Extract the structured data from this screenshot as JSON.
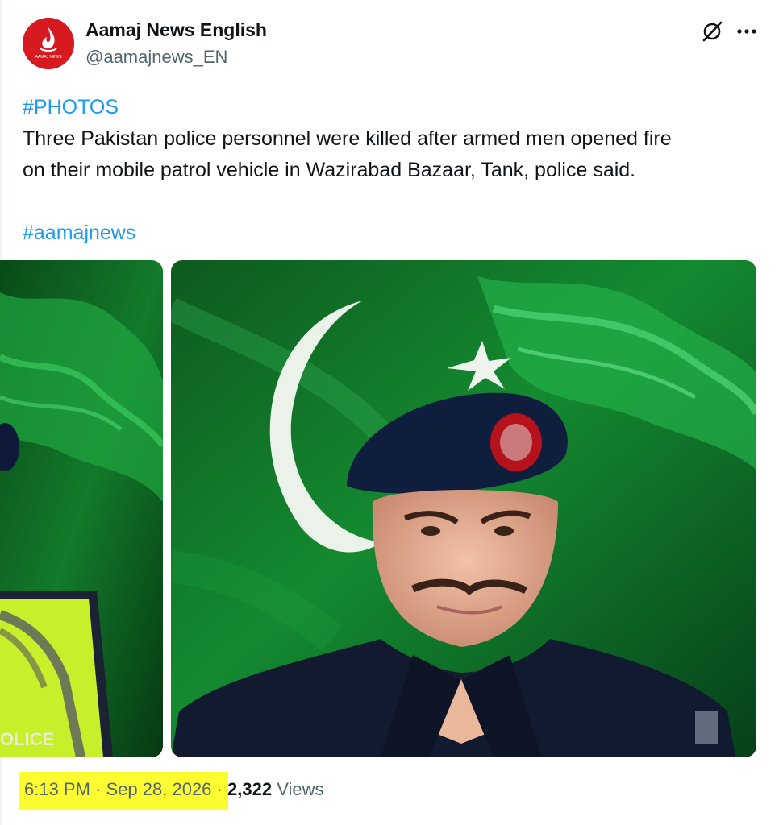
{
  "author": {
    "name": "Aamaj News English",
    "handle": "@aamajnews_EN",
    "avatar_text": "AAMAJ NEWS"
  },
  "tweet": {
    "hashtag_top": "#PHOTOS",
    "text_line_1": "Three Pakistan police personnel were killed after armed men opened fire",
    "text_line_2": "on their mobile patrol vehicle in Wazirabad Bazaar, Tank, police said.",
    "hashtag_bottom": "#aamajnews"
  },
  "media": {
    "left_vest_text": "OLICE"
  },
  "footer": {
    "time": "6:13 PM",
    "separator": "·",
    "date": "Sep 28, 2026",
    "separator2": "·",
    "views_count": "2,322",
    "views_label": "Views"
  },
  "colors": {
    "link": "#1d9bf0",
    "secondary_text": "#536471",
    "highlight": "#fdfc30",
    "avatar_bg": "#d71920",
    "flag_green": "#0b5e1f"
  },
  "icons": {
    "grok": "grok-icon",
    "more": "more-options-icon"
  }
}
